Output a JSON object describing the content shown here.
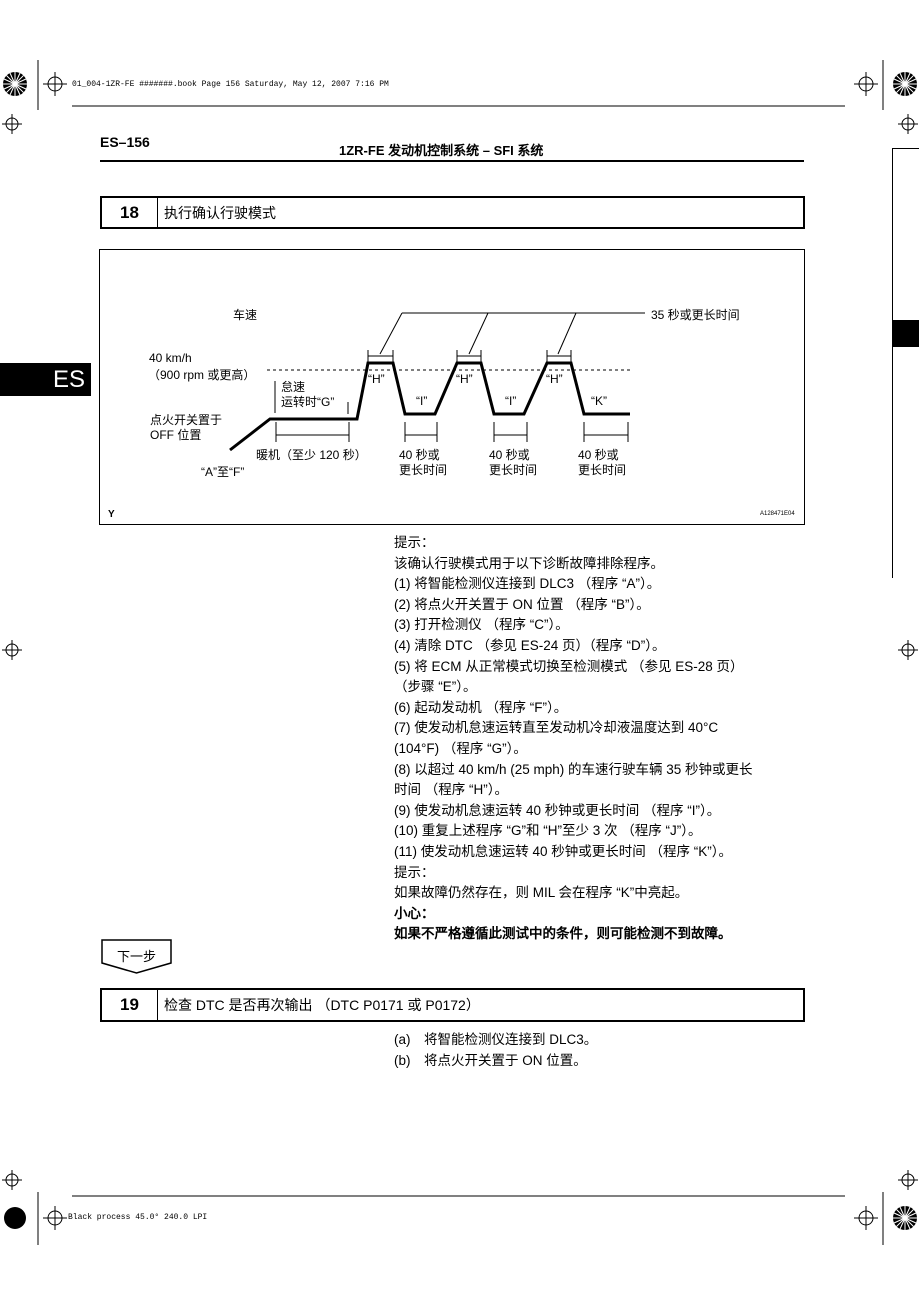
{
  "slug": "01_004-1ZR-FE #######.book  Page 156  Saturday, May 12, 2007  7:16 PM",
  "header": {
    "page_no": "ES–156",
    "title": "1ZR-FE 发动机控制系统  –  SFI 系统"
  },
  "side_tab": "ES",
  "step18": {
    "num": "18",
    "title": "执行确认行驶模式"
  },
  "diagram": {
    "label_speed": "车速",
    "label_35s": "35 秒或更长时间",
    "label_40kmh": "40 km/h",
    "label_rpm": "（900 rpm 或更高）",
    "label_idle_a": "怠速",
    "label_idle_b": "运转时“G”",
    "label_ign_a": "点火开关置于",
    "label_ign_b": "OFF 位置",
    "label_af": "“A”至“F”",
    "label_warm": "暖机（至少 120 秒）",
    "label_h1": "“H”",
    "label_h2": "“H”",
    "label_h3": "“H”",
    "label_i1": "“I”",
    "label_i2": "“I”",
    "label_k": "“K”",
    "label_40s_a": "40 秒或",
    "label_40s_b": "更长时间",
    "label_y": "Y",
    "figure_id": "A128471E04"
  },
  "hint1_label": "提示：",
  "hint1_lines": [
    "该确认行驶模式用于以下诊断故障排除程序。",
    "(1) 将智能检测仪连接到 DLC3 （程序 “A”）。",
    "(2) 将点火开关置于 ON 位置 （程序 “B”）。",
    "(3) 打开检测仪 （程序 “C”）。",
    "(4) 清除 DTC （参见 ES-24 页）（程序 “D”）。",
    "(5) 将 ECM 从正常模式切换至检测模式 （参见 ES-28 页）",
    "（步骤 “E”）。",
    "(6) 起动发动机 （程序 “F”）。",
    "(7) 使发动机怠速运转直至发动机冷却液温度达到 40°C",
    "(104°F) （程序 “G”）。",
    "(8) 以超过 40 km/h (25 mph) 的车速行驶车辆 35 秒钟或更长",
    "时间 （程序 “H”）。",
    "(9) 使发动机怠速运转 40 秒钟或更长时间 （程序 “I”）。",
    "(10) 重复上述程序 “G”和 “H”至少 3 次 （程序 “J”）。",
    "(11) 使发动机怠速运转 40 秒钟或更长时间 （程序 “K”）。"
  ],
  "hint2_label": "提示：",
  "hint2_text": "如果故障仍然存在，则 MIL 会在程序 “K”中亮起。",
  "caution_label": "小心：",
  "caution_text": "如果不严格遵循此测试中的条件，则可能检测不到故障。",
  "next_button": "下一步",
  "step19": {
    "num": "19",
    "title": "检查 DTC 是否再次输出 （DTC P0171 或 P0172）"
  },
  "step19_items": [
    {
      "label": "(a)",
      "text": "将智能检测仪连接到 DLC3。"
    },
    {
      "label": "(b)",
      "text": "将点火开关置于 ON 位置。"
    }
  ],
  "footer_slug": "Black process 45.0°  240.0 LPI"
}
